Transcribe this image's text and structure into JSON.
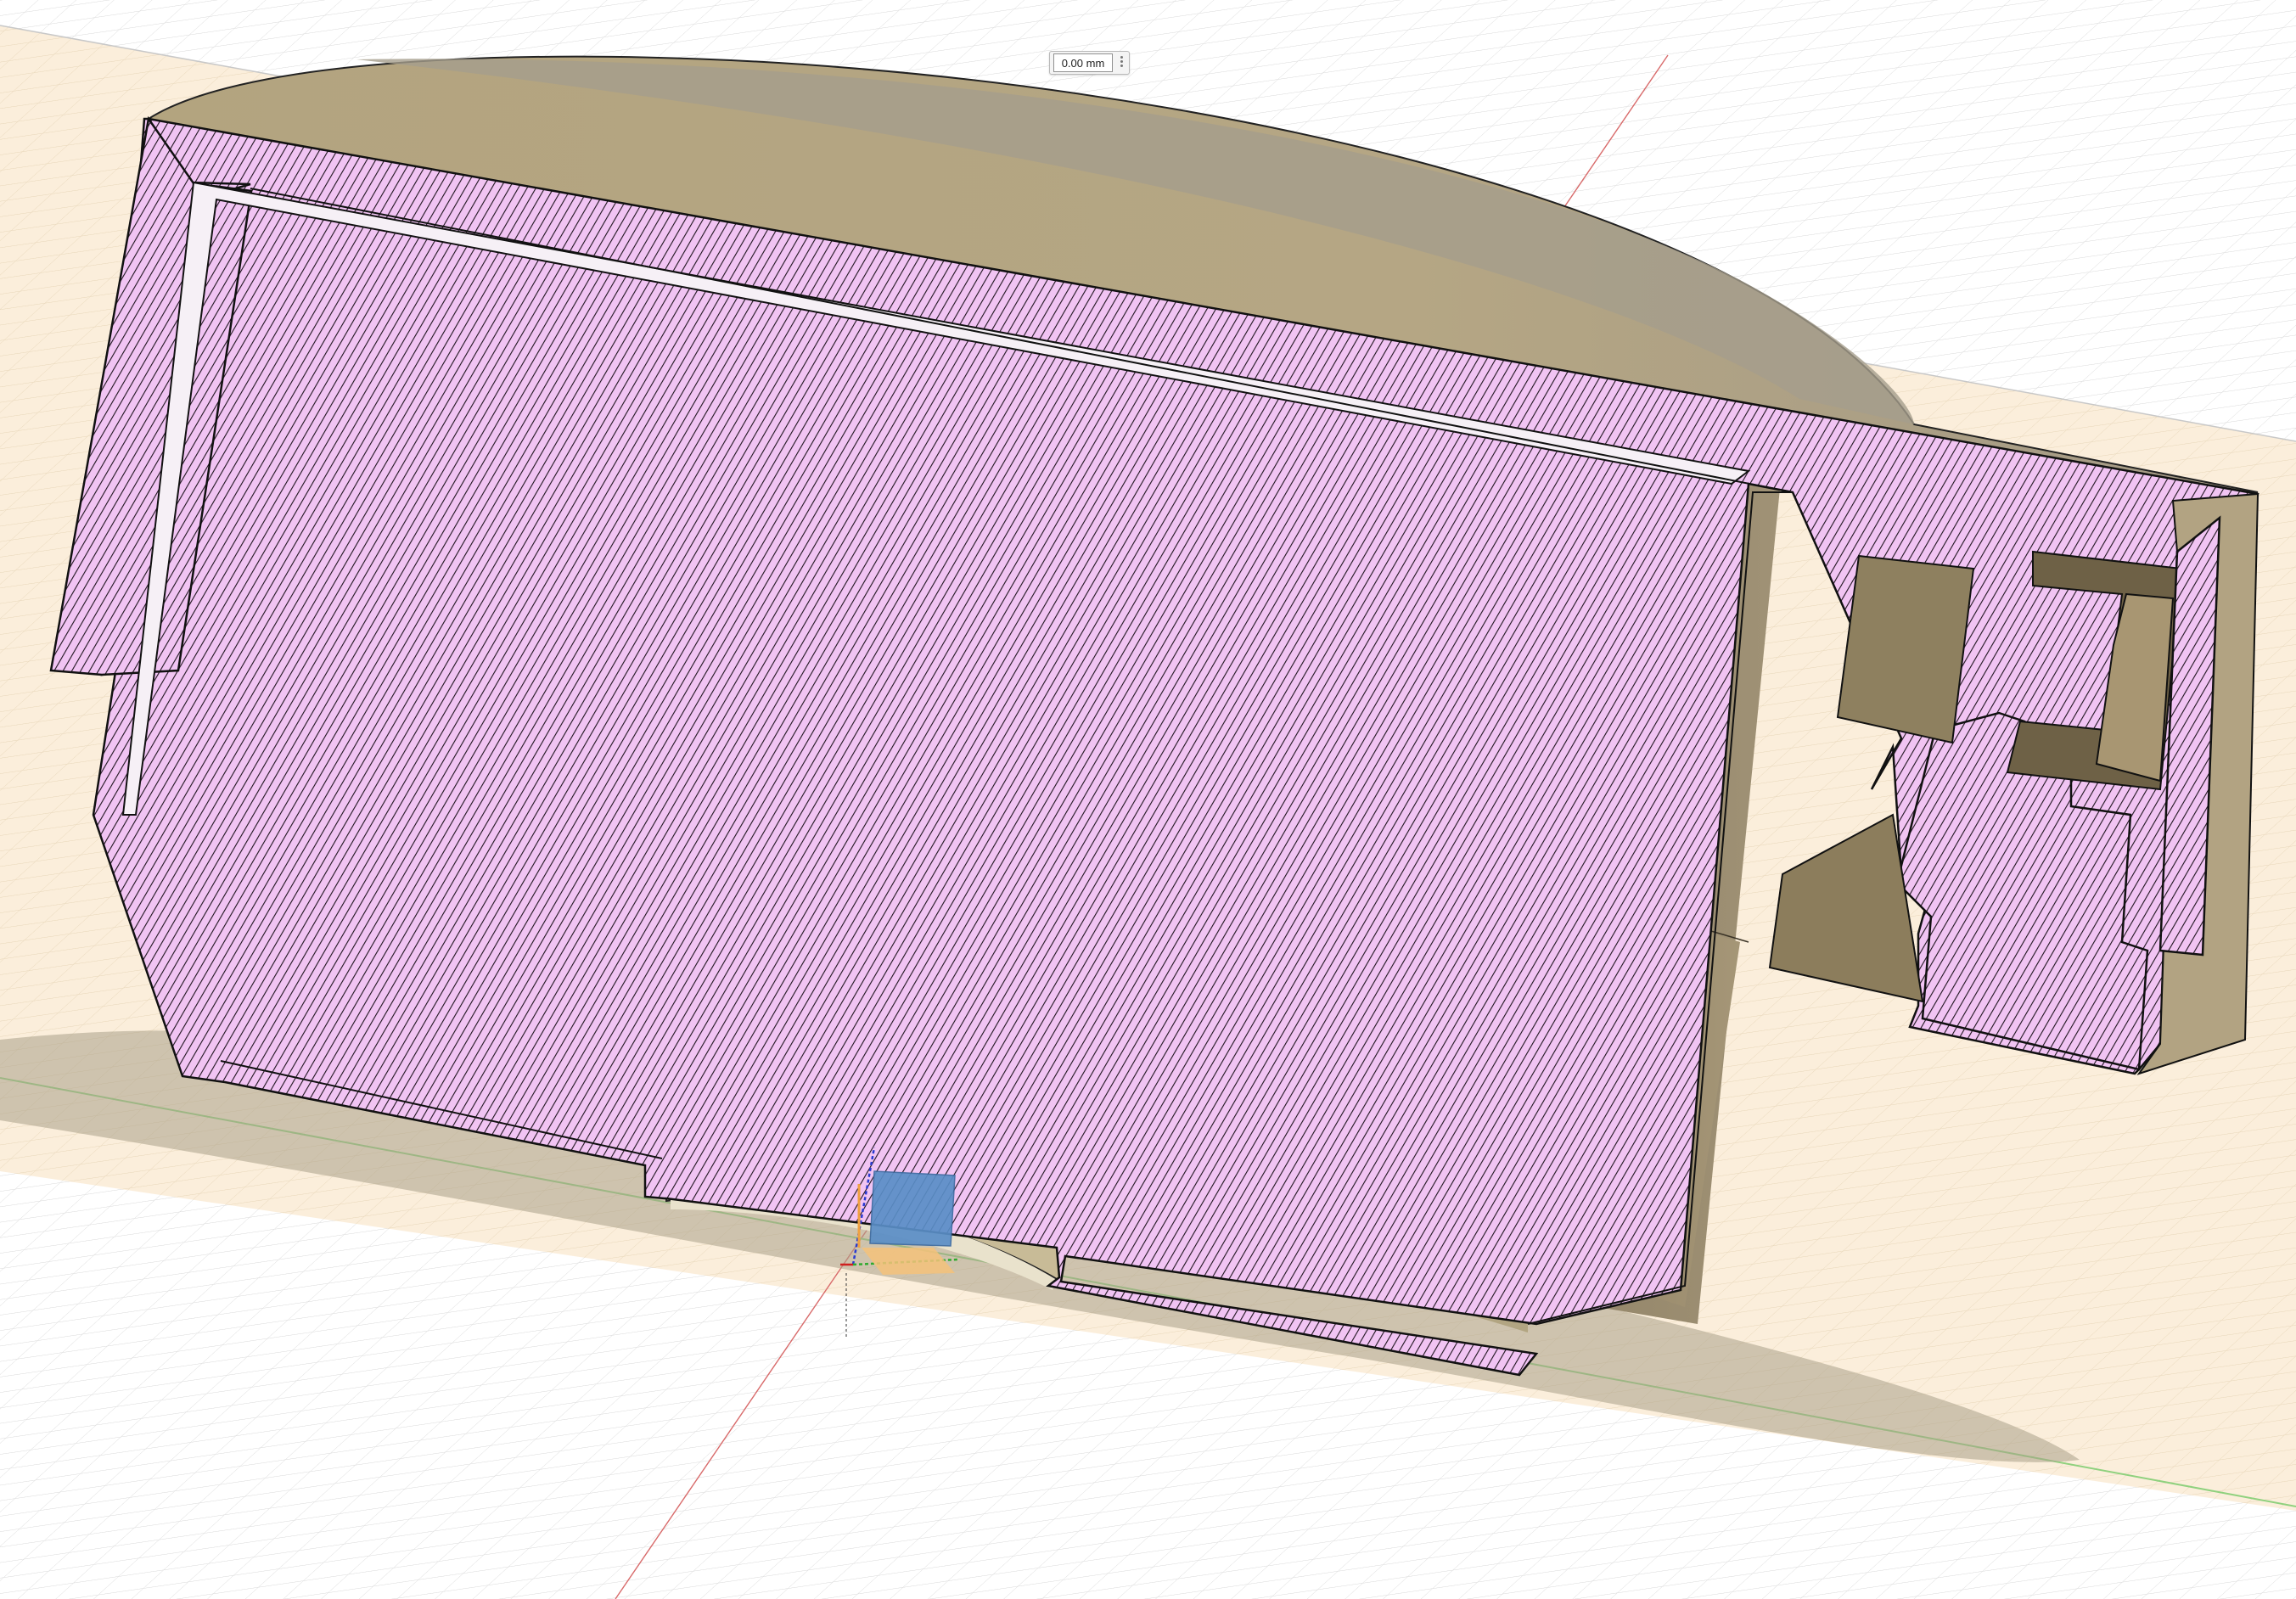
{
  "app": {
    "view": "section-analysis-3d-viewport"
  },
  "dimension_input": {
    "value": "0.00 mm",
    "menu_icon": "more-vertical-icon"
  },
  "colors": {
    "background": "#ffffff",
    "ground_plane": "#fbeedb",
    "grid_minor": "#e3e3e3",
    "grid_major": "#c9c9c9",
    "section_hatch_fill": "#f1c4f3",
    "section_hatch_lines": "#1e141e",
    "body_shell": "#a8977a",
    "body_inner": "#8b7c62",
    "body_highlight": "#f2e6cb",
    "outline": "#1a1a1a",
    "axis_x": "#d02020",
    "axis_y": "#2eaa2e",
    "axis_z": "#2a3ad0",
    "manipulator_cube": "#5a8ec7",
    "manipulator_plane": "#f5c27a"
  },
  "icons": [
    "origin-axes-icon",
    "move-manipulator-icon",
    "more-vertical-icon"
  ]
}
